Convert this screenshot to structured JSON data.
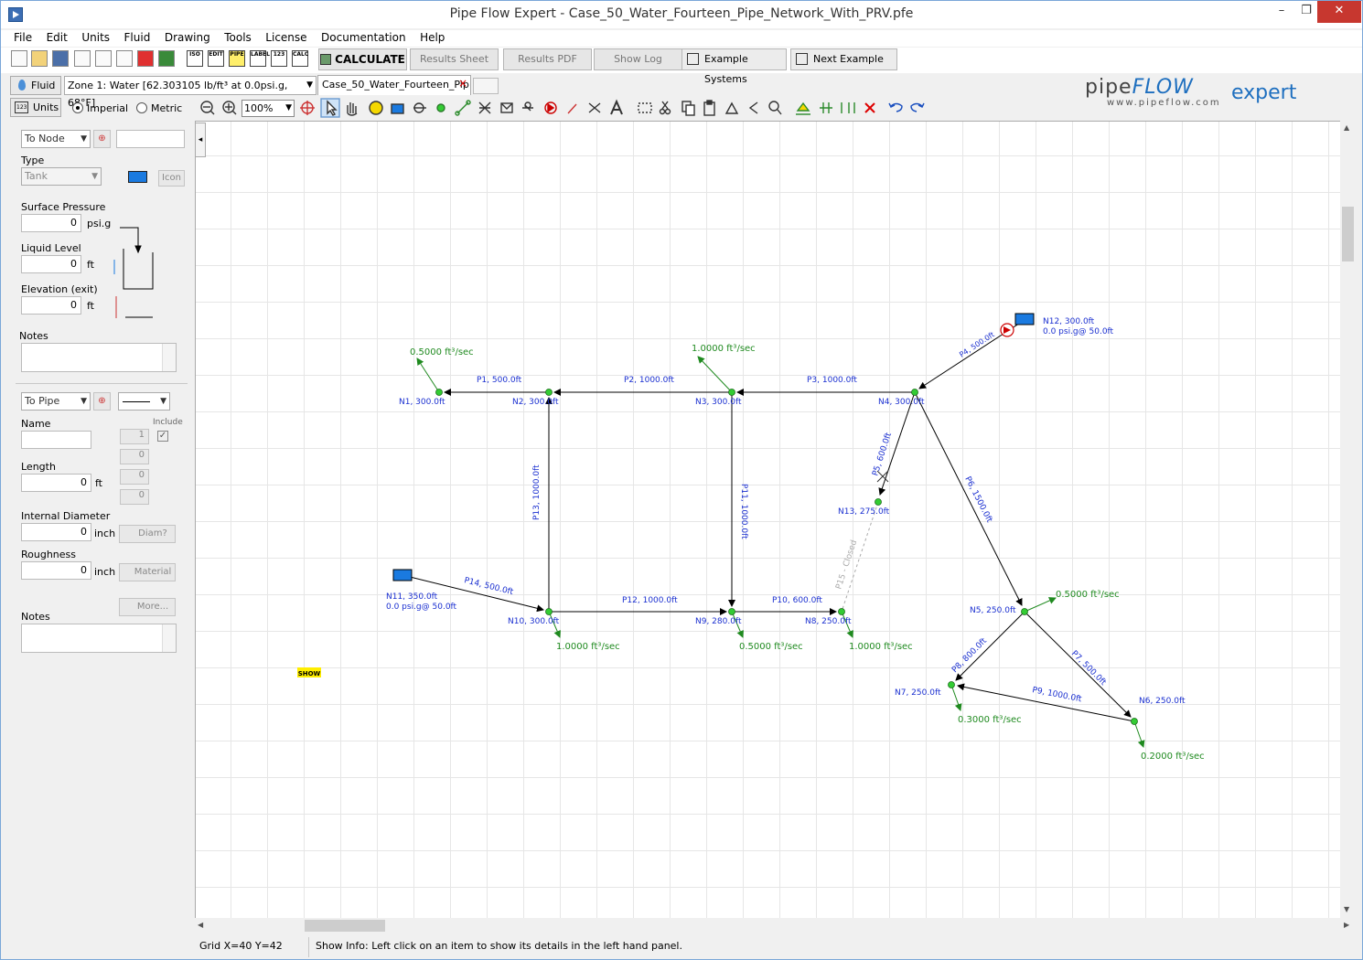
{
  "window": {
    "title": "Pipe Flow Expert - Case_50_Water_Fourteen_Pipe_Network_With_PRV.pfe",
    "min": "–",
    "max": "❐",
    "close": "✕"
  },
  "menu": [
    "File",
    "Edit",
    "Units",
    "Fluid",
    "Drawing",
    "Tools",
    "License",
    "Documentation",
    "Help"
  ],
  "toolbar": {
    "calculate": "CALCULATE",
    "results_sheet": "Results Sheet",
    "results_pdf": "Results PDF",
    "show_log": "Show Log",
    "example_systems": "Example Systems",
    "next_example": "Next Example"
  },
  "fluid": {
    "button": "Fluid",
    "zone": "Zone 1: Water [62.303105 lb/ft³ at 0.0psi.g, 68°F]"
  },
  "tab": {
    "label": "Case_50_Water_Fourteen_Pip",
    "close": "×"
  },
  "logo": {
    "pipe": "pipe",
    "flow": "FLOW",
    "expert": "expert",
    "url": "www.pipeflow.com"
  },
  "units": {
    "button": "Units",
    "imperial": "Imperial",
    "metric": "Metric",
    "zoom": "100%"
  },
  "node_panel": {
    "to_node": "To Node",
    "type_label": "Type",
    "type_value": "Tank",
    "icon_btn": "Icon",
    "surface_pressure_label": "Surface Pressure",
    "surface_pressure_value": "0",
    "surface_pressure_unit": "psi.g",
    "liquid_level_label": "Liquid Level",
    "liquid_level_value": "0",
    "liquid_level_unit": "ft",
    "elevation_label": "Elevation (exit)",
    "elevation_value": "0",
    "elevation_unit": "ft",
    "notes_label": "Notes"
  },
  "pipe_panel": {
    "to_pipe": "To Pipe",
    "name_label": "Name",
    "include_label": "Include",
    "count1": "1",
    "count2": "0",
    "count3": "0",
    "count4": "0",
    "length_label": "Length",
    "length_value": "0",
    "length_unit": "ft",
    "diameter_label": "Internal Diameter",
    "diameter_value": "0",
    "diameter_unit": "inch",
    "diam_btn": "Diam?",
    "roughness_label": "Roughness",
    "roughness_value": "0",
    "roughness_unit": "inch",
    "material_btn": "Material",
    "more_btn": "More...",
    "notes_label": "Notes"
  },
  "diagram": {
    "show_tag": "SHOW",
    "nodes": [
      {
        "id": "n1",
        "label": "N1, 300.0ft"
      },
      {
        "id": "n2",
        "label": "N2, 300.0ft"
      },
      {
        "id": "n3",
        "label": "N3, 300.0ft"
      },
      {
        "id": "n4",
        "label": "N4, 300.0ft"
      },
      {
        "id": "n5",
        "label": "N5, 250.0ft"
      },
      {
        "id": "n6",
        "label": "N6, 250.0ft"
      },
      {
        "id": "n7",
        "label": "N7, 250.0ft"
      },
      {
        "id": "n8",
        "label": "N8, 250.0ft"
      },
      {
        "id": "n9",
        "label": "N9, 280.0ft"
      },
      {
        "id": "n10",
        "label": "N10, 300.0ft"
      },
      {
        "id": "n13",
        "label": "N13, 275.0ft"
      }
    ],
    "tanks": [
      {
        "id": "n11",
        "label": "N11, 350.0ft",
        "sub": "0.0 psi.g@ 50.0ft"
      },
      {
        "id": "n12",
        "label": "N12, 300.0ft",
        "sub": "0.0 psi.g@ 50.0ft"
      }
    ],
    "pipes": [
      {
        "id": "p1",
        "label": "P1, 500.0ft"
      },
      {
        "id": "p2",
        "label": "P2, 1000.0ft"
      },
      {
        "id": "p3",
        "label": "P3, 1000.0ft"
      },
      {
        "id": "p4",
        "label": "P4, 500.0ft"
      },
      {
        "id": "p5",
        "label": "P5, 600.0ft"
      },
      {
        "id": "p6",
        "label": "P6, 1500.0ft"
      },
      {
        "id": "p7",
        "label": "P7, 500.0ft"
      },
      {
        "id": "p8",
        "label": "P8, 800.0ft"
      },
      {
        "id": "p9",
        "label": "P9, 1000.0ft"
      },
      {
        "id": "p10",
        "label": "P10, 600.0ft"
      },
      {
        "id": "p11",
        "label": "P11, 1000.0ft"
      },
      {
        "id": "p12",
        "label": "P12, 1000.0ft"
      },
      {
        "id": "p13",
        "label": "P13, 1000.0ft"
      },
      {
        "id": "p14",
        "label": "P14, 500.0ft"
      },
      {
        "id": "p15",
        "label": "P15 - Closed"
      }
    ],
    "demands": [
      {
        "id": "d1",
        "label": "0.5000 ft³/sec"
      },
      {
        "id": "d3",
        "label": "1.0000 ft³/sec"
      },
      {
        "id": "d5",
        "label": "0.5000 ft³/sec"
      },
      {
        "id": "d6",
        "label": "0.2000 ft³/sec"
      },
      {
        "id": "d7",
        "label": "0.3000 ft³/sec"
      },
      {
        "id": "d8",
        "label": "1.0000 ft³/sec"
      },
      {
        "id": "d9",
        "label": "0.5000 ft³/sec"
      },
      {
        "id": "d10",
        "label": "1.0000 ft³/sec"
      }
    ]
  },
  "status": {
    "grid": "Grid  X=40  Y=42",
    "info": "Show Info: Left click on an item to show its details in the left hand panel."
  },
  "colors": {
    "pipe_label": "#1a2fd0",
    "node": "#33cc33",
    "demand": "#228822",
    "tank": "#1a7ae0"
  }
}
